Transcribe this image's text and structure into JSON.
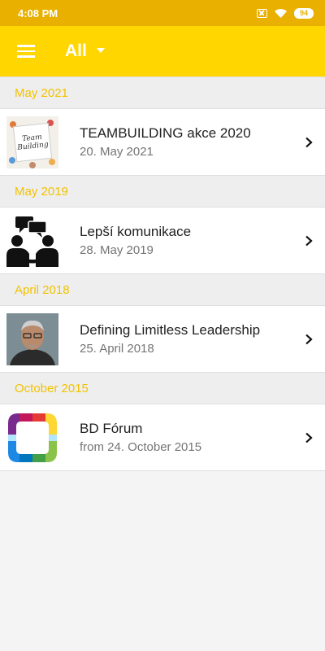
{
  "status_bar": {
    "time": "4:08 PM",
    "battery": "94"
  },
  "app_bar": {
    "filter_label": "All"
  },
  "sections": [
    {
      "header": "May 2021",
      "item": {
        "title": "TEAMBUILDING akce 2020",
        "subtitle": "20. May 2021",
        "thumb_text_1": "Team",
        "thumb_text_2": "Building"
      }
    },
    {
      "header": "May 2019",
      "item": {
        "title": "Lepší komunikace",
        "subtitle": "28. May 2019"
      }
    },
    {
      "header": "April 2018",
      "item": {
        "title": "Defining Limitless Leadership",
        "subtitle": "25. April 2018"
      }
    },
    {
      "header": "October 2015",
      "item": {
        "title": "BD Fórum",
        "subtitle": "from 24. October 2015"
      }
    }
  ]
}
